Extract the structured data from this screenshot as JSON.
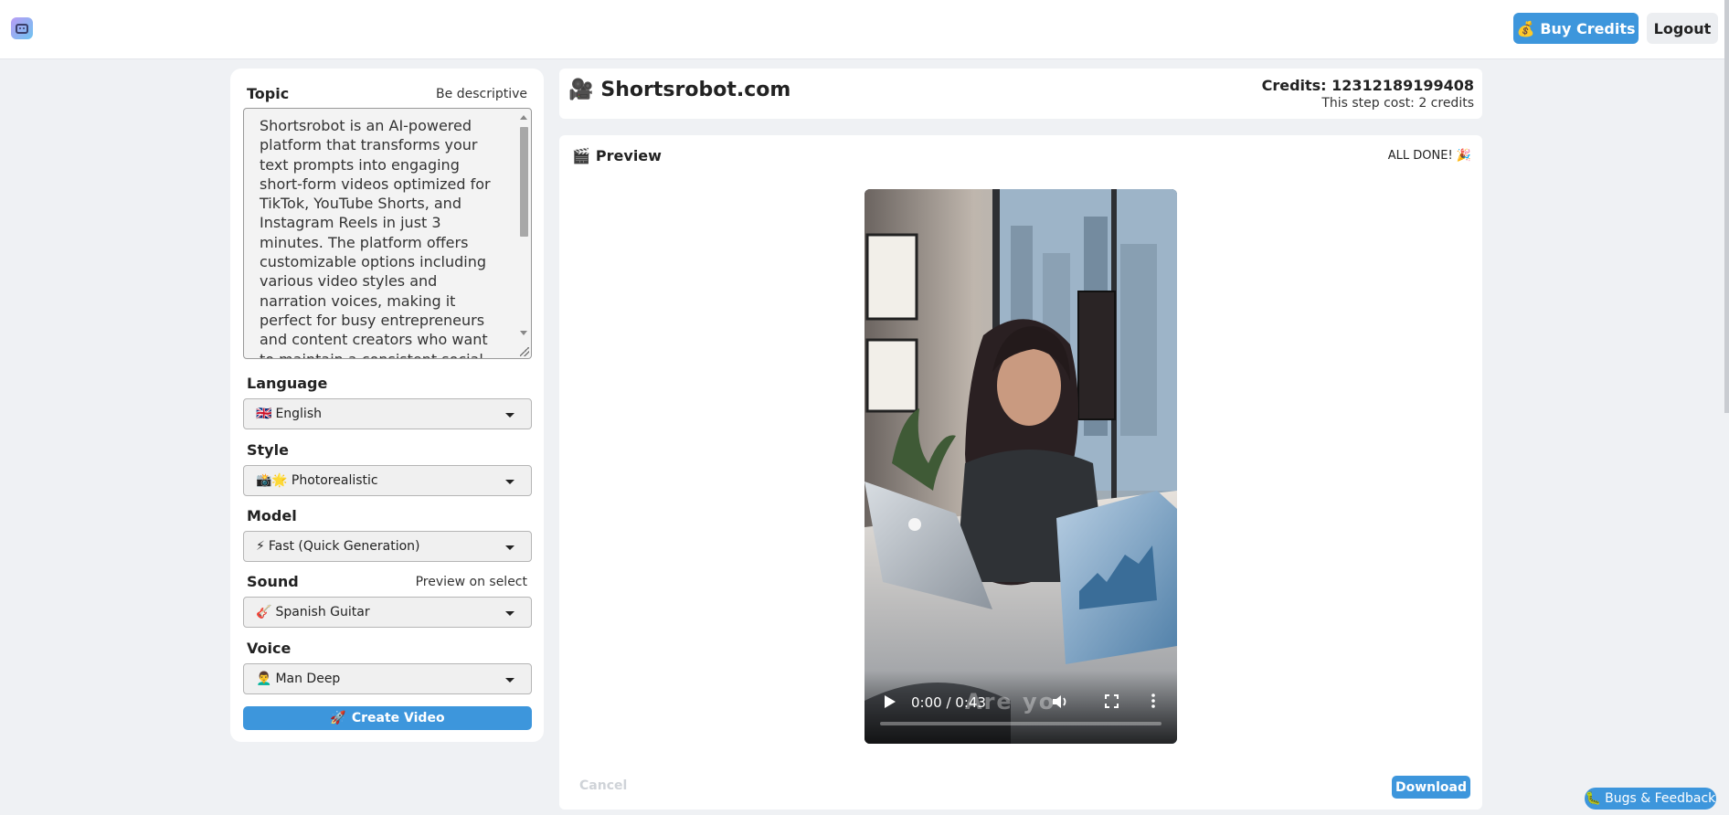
{
  "header": {
    "buy_credits_label": "Buy Credits",
    "buy_credits_icon": "💰",
    "logout_label": "Logout"
  },
  "form": {
    "topic": {
      "label": "Topic",
      "hint": "Be descriptive",
      "value": "Shortsrobot is an AI-powered platform that transforms your text prompts into engaging short-form videos optimized for TikTok, YouTube Shorts, and Instagram Reels in just 3 minutes. The platform offers customizable options including various video styles and narration voices, making it perfect for busy entrepreneurs and content creators who want to maintain a consistent social media presence."
    },
    "language": {
      "label": "Language",
      "value": "English",
      "icon": "🇬🇧"
    },
    "style": {
      "label": "Style",
      "value": "Photorealistic",
      "icon": "📸🌟"
    },
    "model": {
      "label": "Model",
      "value": "Fast (Quick Generation)",
      "icon": "⚡"
    },
    "sound": {
      "label": "Sound",
      "hint": "Preview on select",
      "value": "Spanish Guitar",
      "icon": "🎸"
    },
    "voice": {
      "label": "Voice",
      "value": "Man Deep",
      "icon": "👨‍🦱"
    },
    "create_label": "Create Video",
    "create_icon": "🚀"
  },
  "site": {
    "title": "Shortsrobot.com",
    "icon": "🎥",
    "credits_text": "Credits: 12312189199408",
    "cost_text": "This step cost: 2 credits"
  },
  "preview": {
    "title": "Preview",
    "icon": "🎬",
    "status": "ALL DONE! 🎉",
    "time": "0:00 / 0:43",
    "caption": "Are yo",
    "progress": 0,
    "cancel_label": "Cancel",
    "download_label": "Download"
  },
  "feedback": {
    "label": "Bugs & Feedback",
    "icon": "🐛"
  },
  "colors": {
    "accent": "#3d96dc",
    "background": "#eff1f4"
  }
}
